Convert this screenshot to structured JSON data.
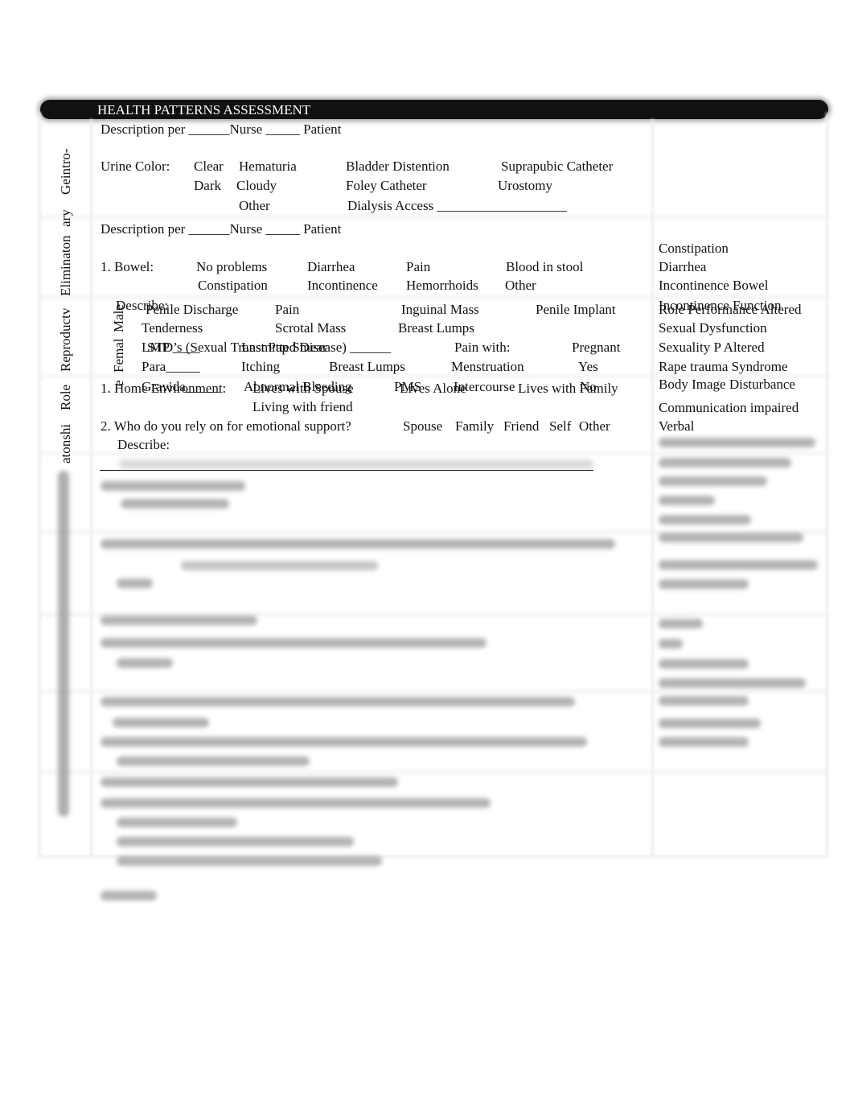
{
  "header": {
    "title": "HEALTH PATTERNS ASSESSMENT"
  },
  "side_labels": {
    "geintro": "Geintro-",
    "ary": "ary",
    "eliminaton": "Eliminaton",
    "reproductv": "Reproductv",
    "role": "Role",
    "atonshi": "atonshi",
    "male": "Male",
    "femal": "Femal",
    "e": "e"
  },
  "urinary": {
    "description_line": "Description per ______Nurse _____ Patient",
    "urine_color_label": "Urine Color:",
    "options_row1": [
      "Clear",
      "Hematuria",
      "Bladder Distention",
      "Suprapubic Catheter"
    ],
    "options_row2": [
      "Dark",
      "Cloudy",
      "Foley Catheter",
      "Urostomy"
    ],
    "options_row3": [
      "Other",
      "Dialysis Access ___________________"
    ]
  },
  "bowel": {
    "description_line": "Description per ______Nurse _____ Patient",
    "label": "1. Bowel:",
    "options_row1": [
      "No problems",
      "Diarrhea",
      "Pain",
      "Blood in stool"
    ],
    "options_row2": [
      "Constipation",
      "Incontinence",
      "Hemorrhoids",
      "Other"
    ],
    "describe": "Describe:"
  },
  "reproductive": {
    "male_row1": [
      "Penile Discharge",
      "Pain",
      "Inguinal Mass",
      "Penile Implant"
    ],
    "male_row2": [
      "Tenderness",
      "Scrotal Mass",
      "Breast Lumps"
    ],
    "std": "STD’s (Sexual Transmitted Disease) ______",
    "lmp": "LMP ____",
    "last_pap": "Last Pap Smear",
    "pain_with": "Pain with:",
    "pregnant": "Pregnant",
    "para": "Para_____",
    "itching": "Itching",
    "breast_lumps": "Breast Lumps",
    "menstruation": "Menstruation",
    "yes": "Yes",
    "gravida": "Gravida_____",
    "abnormal_bleeding": "Abnormal Bleeding",
    "pms": "PMS",
    "intercourse": "Intercourse",
    "no": "No"
  },
  "role": {
    "home_env": "1. Home Environment:",
    "lives_with_spouse": "Lives with Spouse",
    "lives_alone": "Lives Alone",
    "lives_with_family": "Lives with Family",
    "living_with_friend": "Living with friend",
    "support_question": "2.  Who do you rely on for emotional support?",
    "support_options": [
      "Spouse",
      "Family",
      "Friend",
      "Self",
      "Other"
    ],
    "describe": "Describe:"
  },
  "nursing_diagnoses": {
    "items": [
      "Constipation",
      "Diarrhea",
      "Incontinence Bowel",
      "Incontinence Function",
      "Role Performance Altered",
      "Sexual Dysfunction",
      "Sexuality P Altered",
      "Rape trauma Syndrome",
      "Body Image Disturbance",
      "Communication impaired",
      "Verbal"
    ]
  }
}
